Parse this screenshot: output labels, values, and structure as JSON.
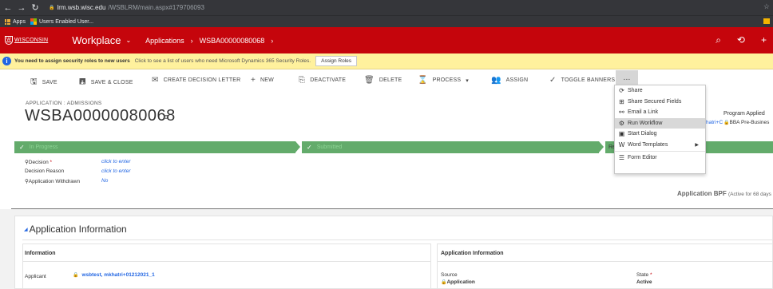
{
  "browser": {
    "url_host": "lrm.wsb.wisc.edu",
    "url_path": "/WSBLRM/main.aspx#179706093",
    "bookmarks": [
      "Apps",
      "Users Enabled User..."
    ]
  },
  "nav": {
    "logo": "WISCONSIN",
    "workplace": "Workplace",
    "breadcrumb": [
      "Applications",
      "WSBA00000080068"
    ]
  },
  "notification": {
    "message": "You need to assign security roles to new users",
    "detail": "Click to see a list of users who need Microsoft Dynamics 365 Security Roles.",
    "button": "Assign Roles"
  },
  "commands": {
    "save": "SAVE",
    "save_close": "SAVE & CLOSE",
    "create_decision_letter": "CREATE DECISION LETTER",
    "new": "NEW",
    "deactivate": "DEACTIVATE",
    "delete": "DELETE",
    "process": "PROCESS",
    "assign": "ASSIGN",
    "toggle_banners": "TOGGLE BANNERS",
    "more": "..."
  },
  "more_menu": [
    "Share",
    "Share Secured Fields",
    "Email a Link",
    "Run Workflow",
    "Start Dialog",
    "Word Templates",
    "Form Editor"
  ],
  "header": {
    "entity": "APPLICATION : ADMISSIONS",
    "record": "WSBA00000080068",
    "program_applied_label": "Program Applied",
    "owner_partial": "hatri+C",
    "program_applied_value": "BBA Pre-Busines"
  },
  "process": {
    "stage1": "In Progress",
    "stage2": "Submitted",
    "stage3": "Review ("
  },
  "fields": [
    {
      "label": "Decision",
      "value": "click to enter"
    },
    {
      "label": "Decision Reason",
      "value": "click to enter"
    },
    {
      "label": "Application Withdrawn",
      "value": "No"
    }
  ],
  "bpf": {
    "name": "Application BPF",
    "status": "(Active for 68 days"
  },
  "section": {
    "title": "Application Information",
    "left_heading": "Information",
    "right_heading": "Application Information",
    "applicant_label": "Applicant",
    "applicant_value": "wsbtest, mkhatri+01212021_1",
    "source_label": "Source",
    "source_value": "Application",
    "state_label": "State",
    "state_value": "Active"
  },
  "colors": {
    "brand_red": "#c5050c",
    "process_green": "#63ab6b",
    "notify_yellow": "#fff19d",
    "link_blue": "#2266e3"
  }
}
